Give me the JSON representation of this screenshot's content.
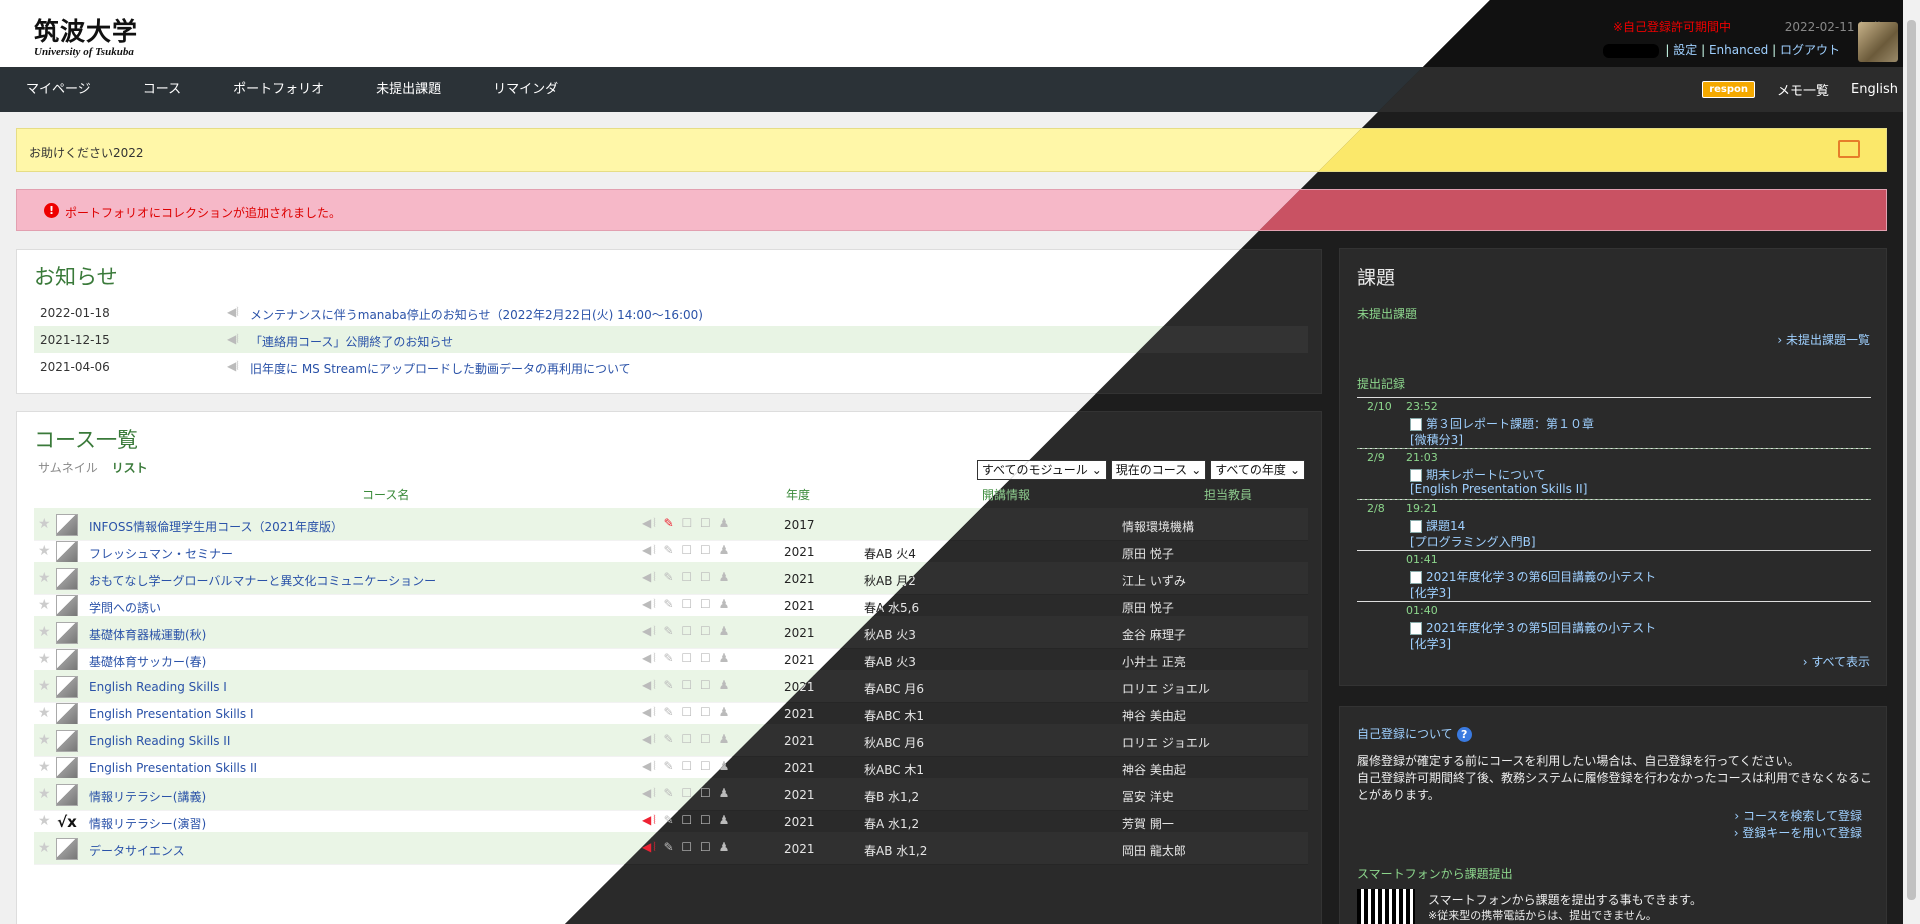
{
  "header": {
    "logo_jp": "筑波大学",
    "logo_en": "University of Tsukuba",
    "warning": "※自己登録許可期間中",
    "date": "2022-02-11 (Fri)",
    "settings": "設定",
    "enhanced": "Enhanced",
    "logout": "ログアウト"
  },
  "nav": {
    "items": [
      "マイページ",
      "コース",
      "ポートフォリオ",
      "未提出課題",
      "リマインダ"
    ],
    "respon": "respon",
    "memo": "メモ一覧",
    "english": "English"
  },
  "banner_yellow": "お助けください2022",
  "banner_pink": "ポートフォリオにコレクションが追加されました。",
  "notices": {
    "title": "お知らせ",
    "rows": [
      {
        "date": "2022-01-18",
        "text": "メンテナンスに伴うmanaba停止のお知らせ（2022年2月22日(火) 14:00～16:00)"
      },
      {
        "date": "2021-12-15",
        "text": "「連絡用コース」公開終了のお知らせ"
      },
      {
        "date": "2021-04-06",
        "text": "旧年度に MS Streamにアップロードした動画データの再利用について"
      }
    ]
  },
  "courses": {
    "title": "コース一覧",
    "tab_thumb": "サムネイル",
    "tab_list": "リスト",
    "select_module": "すべてのモジュール",
    "select_current": "現在のコース",
    "select_year": "すべての年度",
    "col_name": "コース名",
    "col_year": "年度",
    "col_info": "開講情報",
    "col_teacher": "担当教員",
    "rows": [
      {
        "name": "INFOSS情報倫理学生用コース（2021年度版）",
        "year": "2017",
        "term": "",
        "teacher": "情報環境機構"
      },
      {
        "name": "フレッシュマン・セミナー",
        "year": "2021",
        "term": "春AB 火4",
        "teacher": "原田 悦子"
      },
      {
        "name": "おもてなし学ーグローバルマナーと異文化コミュニケーションー",
        "year": "2021",
        "term": "秋AB 月2",
        "teacher": "江上 いずみ"
      },
      {
        "name": "学問への誘い",
        "year": "2021",
        "term": "春A 水5,6",
        "teacher": "原田 悦子"
      },
      {
        "name": "基礎体育器械運動(秋)",
        "year": "2021",
        "term": "秋AB 火3",
        "teacher": "金谷 麻理子"
      },
      {
        "name": "基礎体育サッカー(春)",
        "year": "2021",
        "term": "春AB 火3",
        "teacher": "小井土 正亮"
      },
      {
        "name": "English Reading Skills I",
        "year": "2021",
        "term": "春ABC 月6",
        "teacher": "ロリエ ジョエル"
      },
      {
        "name": "English Presentation Skills I",
        "year": "2021",
        "term": "春ABC 木1",
        "teacher": "神谷 美由起"
      },
      {
        "name": "English Reading Skills II",
        "year": "2021",
        "term": "秋ABC 月6",
        "teacher": "ロリエ ジョエル"
      },
      {
        "name": "English Presentation Skills II",
        "year": "2021",
        "term": "秋ABC 木1",
        "teacher": "神谷 美由起"
      },
      {
        "name": "情報リテラシー(講義)",
        "year": "2021",
        "term": "春B 水1,2",
        "teacher": "冨安 洋史"
      },
      {
        "name": "情報リテラシー(演習)",
        "year": "2021",
        "term": "春A 水1,2",
        "teacher": "芳賀 開一"
      },
      {
        "name": "データサイエンス",
        "year": "2021",
        "term": "春AB 水1,2",
        "teacher": "岡田 龍太郎"
      }
    ]
  },
  "tasks": {
    "title": "課題",
    "unsubmitted": "未提出課題",
    "unsubmitted_link": "未提出課題一覧",
    "history": "提出記録",
    "entries": [
      {
        "date": "2/10",
        "time": "23:52",
        "title": "第３回レポート課題：第１０章",
        "course": "[微積分3]"
      },
      {
        "date": "2/9",
        "time": "21:03",
        "title": "期末レポートについて",
        "course": "[English Presentation Skills II]"
      },
      {
        "date": "2/8",
        "time": "19:21",
        "title": "課題14",
        "course": "[プログラミング入門B]"
      },
      {
        "date": "",
        "time": "01:41",
        "title": "2021年度化学３の第6回目講義の小テスト",
        "course": "[化学3]"
      },
      {
        "date": "",
        "time": "01:40",
        "title": "2021年度化学３の第5回目講義の小テスト",
        "course": "[化学3]"
      }
    ],
    "show_all": "すべて表示"
  },
  "selfreg": {
    "title": "自己登録について",
    "desc1": "履修登録が確定する前にコースを利用したい場合は、自己登録を行ってください。",
    "desc2": "自己登録許可期間終了後、教務システムに履修登録を行わなかったコースは利用できなくなることがあります。",
    "link1": "コースを検索して登録",
    "link2": "登録キーを用いて登録",
    "sp_title": "スマートフォンから課題提出",
    "sp1": "スマートフォンから課題を提出する事もできます。",
    "sp2": "※従来型の携帯電話からは、提出できません。"
  }
}
